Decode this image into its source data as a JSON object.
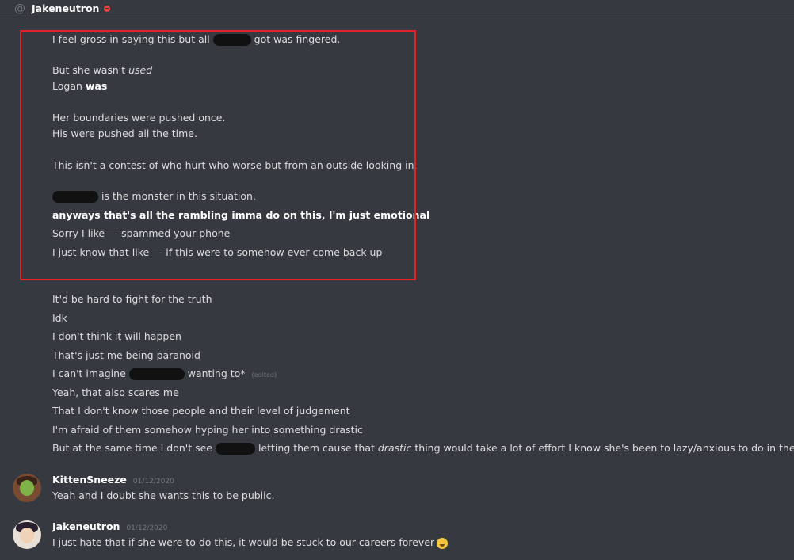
{
  "header": {
    "username": "Jakeneutron"
  },
  "highlighted_messages": {
    "l1_pre": "I feel gross in saying this but all",
    "l1_post": "got was fingered.",
    "l2_pre": "But she wasn't ",
    "l2_em": "used",
    "l3_pre": "Logan ",
    "l3_bold": "was",
    "l4": "Her boundaries were pushed once.",
    "l5": "His were pushed all the time.",
    "l6": "This isn't a contest of who hurt who worse but from an outside looking in.",
    "l7_post": "is the monster in this situation.",
    "l8": "anyways that's all the rambling imma do on this, I'm just emotional",
    "l9": "Sorry I like—- spammed your phone",
    "l10": "I just know that like—- if this were to somehow ever come back up"
  },
  "messages": {
    "m1": "It'd be hard to fight for the truth",
    "m2": "Idk",
    "m3": "I don't think it will happen",
    "m4": "That's just me being paranoid",
    "m5_pre": "I can't imagine",
    "m5_post": "wanting to*",
    "m5_edited": "(edited)",
    "m6": "Yeah, that also scares me",
    "m7": "That I don't know those people and their level of judgement",
    "m8": "I'm afraid of them somehow hyping her into something drastic",
    "m9_pre": "But at the same time I don't see",
    "m9_mid": "letting them cause that ",
    "m9_em": "drastic",
    "m9_post": " thing would take a lot of effort I know she's been to lazy/anxious to do in the past."
  },
  "kitten_message": {
    "author": "KittenSneeze",
    "timestamp": "01/12/2020",
    "text": "Yeah and I doubt she wants this to be public."
  },
  "jake_message": {
    "author": "Jakeneutron",
    "timestamp": "01/12/2020",
    "text": "I just hate that if she were to do this, it would be stuck to our careers forever",
    "emoji": "weary-face-icon"
  },
  "colors": {
    "background": "#36393f",
    "text": "#dcddde",
    "highlight_border": "#e2212b",
    "dnd_status": "#ed4245"
  }
}
